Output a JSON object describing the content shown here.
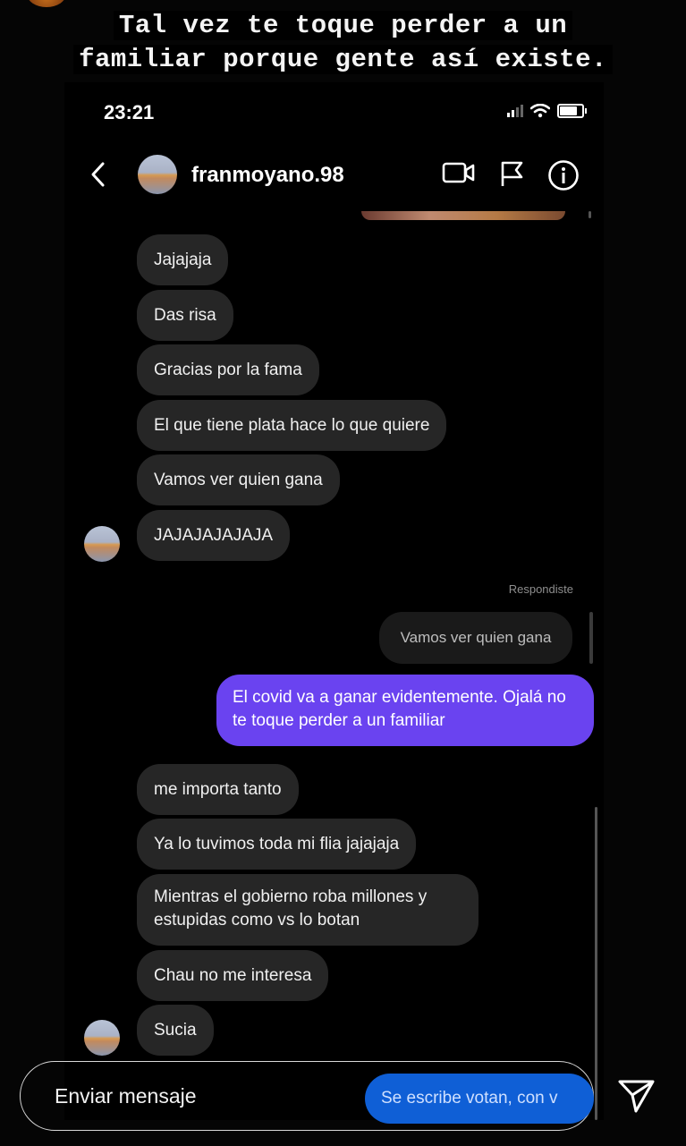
{
  "story": {
    "caption_line1": "Tal vez te toque perder a un",
    "caption_line2": "familiar porque gente así existe."
  },
  "phone": {
    "time": "23:21",
    "username": "franmoyano.98"
  },
  "messages_before": [
    "Jajajaja",
    "Das risa",
    "Gracias por la fama",
    "El que tiene plata hace lo que quiere",
    "Vamos ver quien gana",
    "JAJAJAJAJAJA"
  ],
  "reply": {
    "label": "Respondiste",
    "quoted": "Vamos ver quien gana",
    "message": "El covid va a ganar evidentemente. Ojalá no te toque perder a un familiar"
  },
  "messages_after": [
    "me  importa tanto",
    "Ya lo tuvimos toda mi flia jajajaja",
    "Mientras el gobierno roba millones y estupidas como vs lo botan",
    "Chau no me interesa",
    "Sucia"
  ],
  "story_reply": {
    "placeholder": "Enviar mensaje",
    "overlay_text": "Se escribe votan, con v"
  },
  "colors": {
    "background": "#050505",
    "their_bubble": "#262626",
    "my_bubble": "#6a43f0",
    "overlay_pill": "#0f5fd6"
  },
  "icons": [
    "back-chevron-icon",
    "video-call-icon",
    "flag-icon",
    "info-icon",
    "send-icon"
  ]
}
